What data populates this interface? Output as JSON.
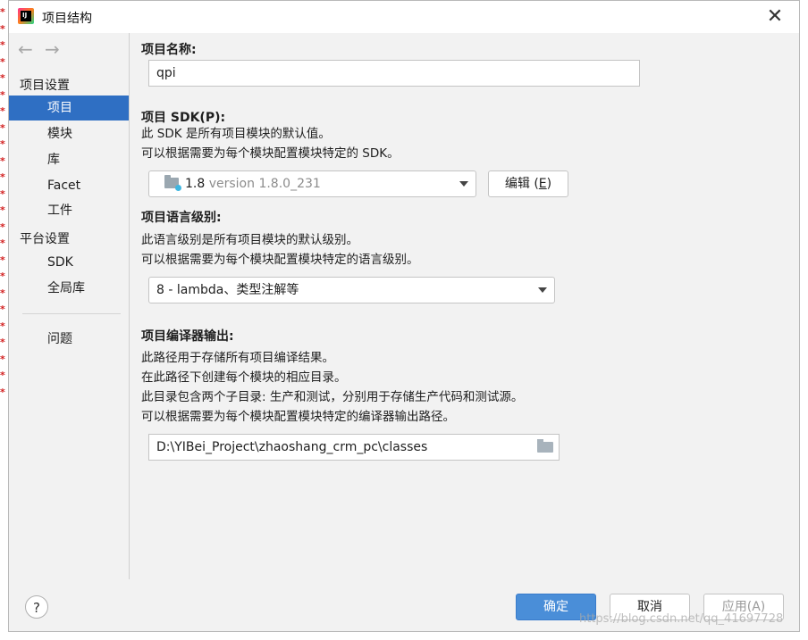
{
  "window": {
    "title": "项目结构",
    "close_glyph": "✕"
  },
  "nav": {
    "back_glyph": "←",
    "forward_glyph": "→"
  },
  "sidebar": {
    "project_settings_header": "项目设置",
    "platform_settings_header": "平台设置",
    "items": [
      {
        "label": "项目",
        "selected": true
      },
      {
        "label": "模块",
        "selected": false
      },
      {
        "label": "库",
        "selected": false
      },
      {
        "label": "Facet",
        "selected": false
      },
      {
        "label": "工件",
        "selected": false
      },
      {
        "label": "SDK",
        "selected": false
      },
      {
        "label": "全局库",
        "selected": false
      },
      {
        "label": "问题",
        "selected": false
      }
    ]
  },
  "project_name": {
    "label": "项目名称:",
    "value": "qpi"
  },
  "project_sdk": {
    "label": "项目 SDK(P):",
    "desc1": "此 SDK 是所有项目模块的默认值。",
    "desc2": "可以根据需要为每个模块配置模块特定的 SDK。",
    "selected_name": "1.8",
    "selected_version": "version 1.8.0_231",
    "edit_label": "编辑 (",
    "edit_mnemonic": "E",
    "edit_suffix": ")"
  },
  "language_level": {
    "label": "项目语言级别:",
    "desc1": "此语言级别是所有项目模块的默认级别。",
    "desc2": "可以根据需要为每个模块配置模块特定的语言级别。",
    "selected": "8 - lambda、类型注解等"
  },
  "compiler_output": {
    "label": "项目编译器输出:",
    "desc1": "此路径用于存储所有项目编译结果。",
    "desc2": "在此路径下创建每个模块的相应目录。",
    "desc3": "此目录包含两个子目录: 生产和测试，分别用于存储生产代码和测试源。",
    "desc4": "可以根据需要为每个模块配置模块特定的编译器输出路径。",
    "path": "D:\\YIBei_Project\\zhaoshang_crm_pc\\classes"
  },
  "footer": {
    "help_glyph": "?",
    "ok_label": "确定",
    "cancel_label": "取消",
    "apply_label": "应用(A)"
  },
  "watermark": "https://blog.csdn.net/qq_41697728",
  "colors": {
    "accent": "#2f6fc3",
    "ok_button": "#4a8ed8",
    "dialog_bg": "#f2f2f2"
  }
}
